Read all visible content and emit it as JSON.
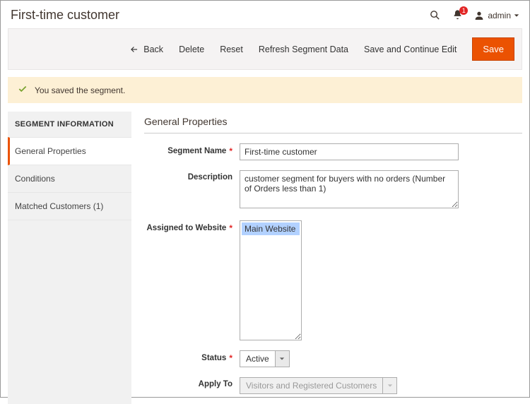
{
  "header": {
    "title": "First-time customer",
    "notification_count": "1",
    "admin_label": "admin"
  },
  "actions": {
    "back": "Back",
    "delete": "Delete",
    "reset": "Reset",
    "refresh": "Refresh Segment Data",
    "save_continue": "Save and Continue Edit",
    "save": "Save"
  },
  "message": {
    "success": "You saved the segment."
  },
  "sidebar": {
    "title": "SEGMENT INFORMATION",
    "items": [
      {
        "label": "General Properties"
      },
      {
        "label": "Conditions"
      },
      {
        "label": "Matched Customers (1)"
      }
    ]
  },
  "form": {
    "section_title": "General Properties",
    "segment_name": {
      "label": "Segment Name",
      "value": "First-time customer"
    },
    "description": {
      "label": "Description",
      "value": "customer segment for buyers with no orders (Number of Orders less than 1)"
    },
    "assigned": {
      "label": "Assigned to Website",
      "option": "Main Website"
    },
    "status": {
      "label": "Status",
      "value": "Active"
    },
    "apply_to": {
      "label": "Apply To",
      "value": "Visitors and Registered Customers"
    }
  }
}
